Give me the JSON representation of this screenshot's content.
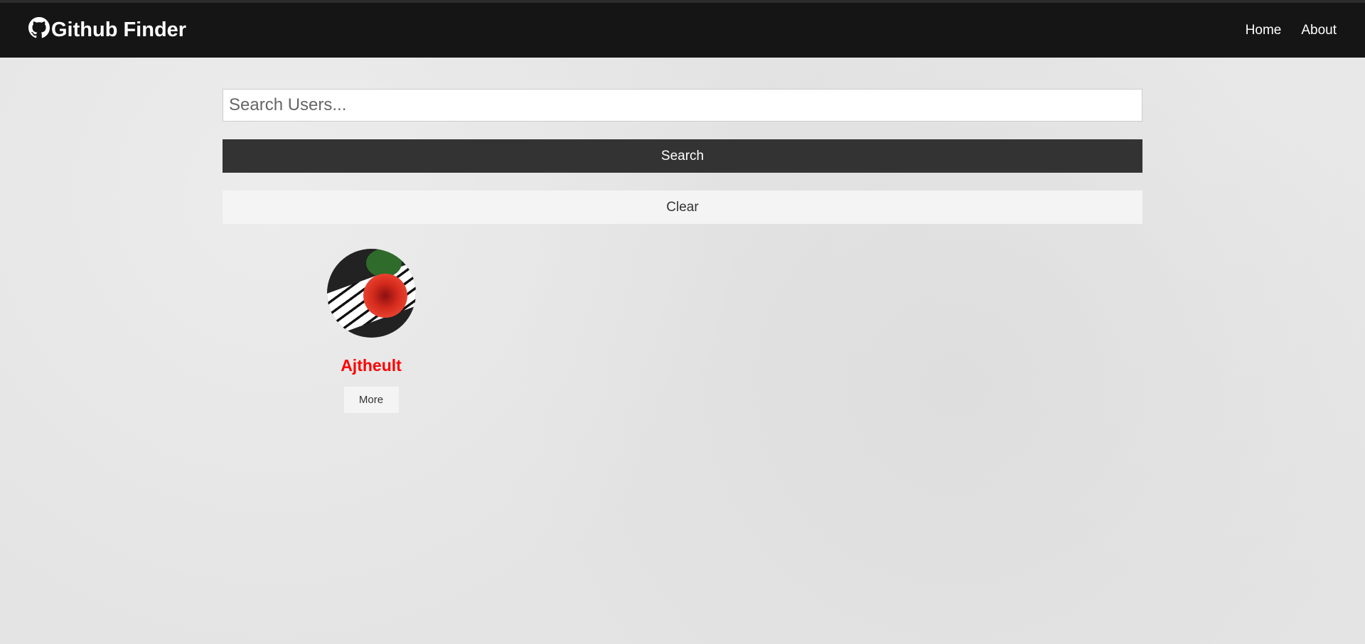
{
  "navbar": {
    "title": "Github Finder",
    "links": [
      "Home",
      "About"
    ]
  },
  "search": {
    "placeholder": "Search Users...",
    "value": "",
    "search_label": "Search",
    "clear_label": "Clear"
  },
  "users": [
    {
      "login": "Ajtheult",
      "more_label": "More"
    }
  ]
}
